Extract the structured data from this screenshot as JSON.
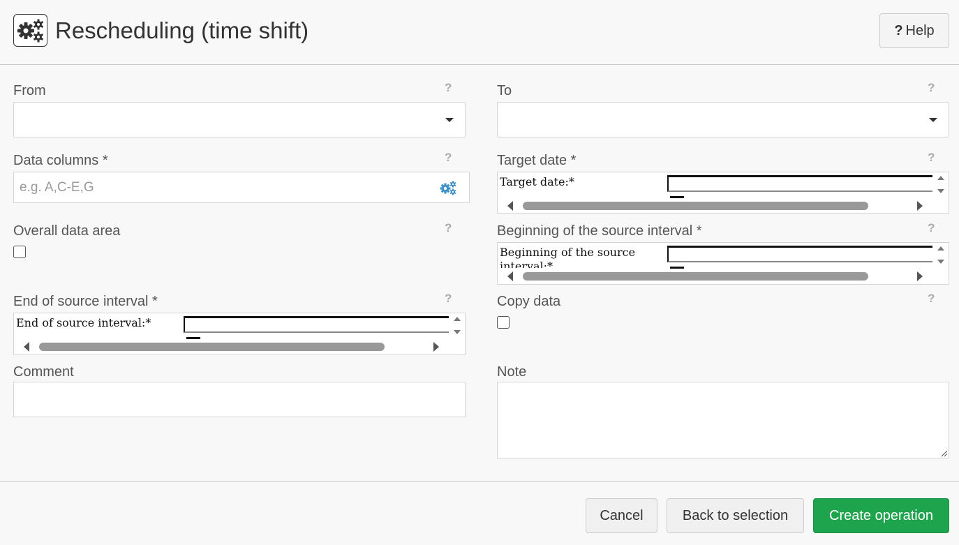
{
  "header": {
    "title": "Rescheduling (time shift)",
    "help_label": "Help",
    "help_glyph": "?"
  },
  "form": {
    "from": {
      "label": "From",
      "value": ""
    },
    "to": {
      "label": "To",
      "value": ""
    },
    "data_columns": {
      "label": "Data columns *",
      "placeholder": "e.g. A,C-E,G",
      "value": ""
    },
    "target_date": {
      "label": "Target date *",
      "widget_label": "Target date:*"
    },
    "overall_data_area": {
      "label": "Overall data area",
      "checked": false
    },
    "beginning_source": {
      "label": "Beginning of the source interval *",
      "widget_label_line1": "Beginning of the source",
      "widget_label_line2": "interval:*"
    },
    "end_source": {
      "label": "End of source interval *",
      "widget_label": "End of source interval:*"
    },
    "copy_data": {
      "label": "Copy data",
      "checked": false
    },
    "comment": {
      "label": "Comment",
      "value": ""
    },
    "note": {
      "label": "Note",
      "value": ""
    },
    "help_glyph": "?"
  },
  "footer": {
    "cancel_label": "Cancel",
    "back_label": "Back to selection",
    "create_label": "Create operation"
  },
  "colors": {
    "primary": "#1ea44c",
    "icon_blue": "#3a8fc7"
  },
  "icons": {
    "logo": "gears-icon",
    "columns_addon": "gears-icon"
  }
}
